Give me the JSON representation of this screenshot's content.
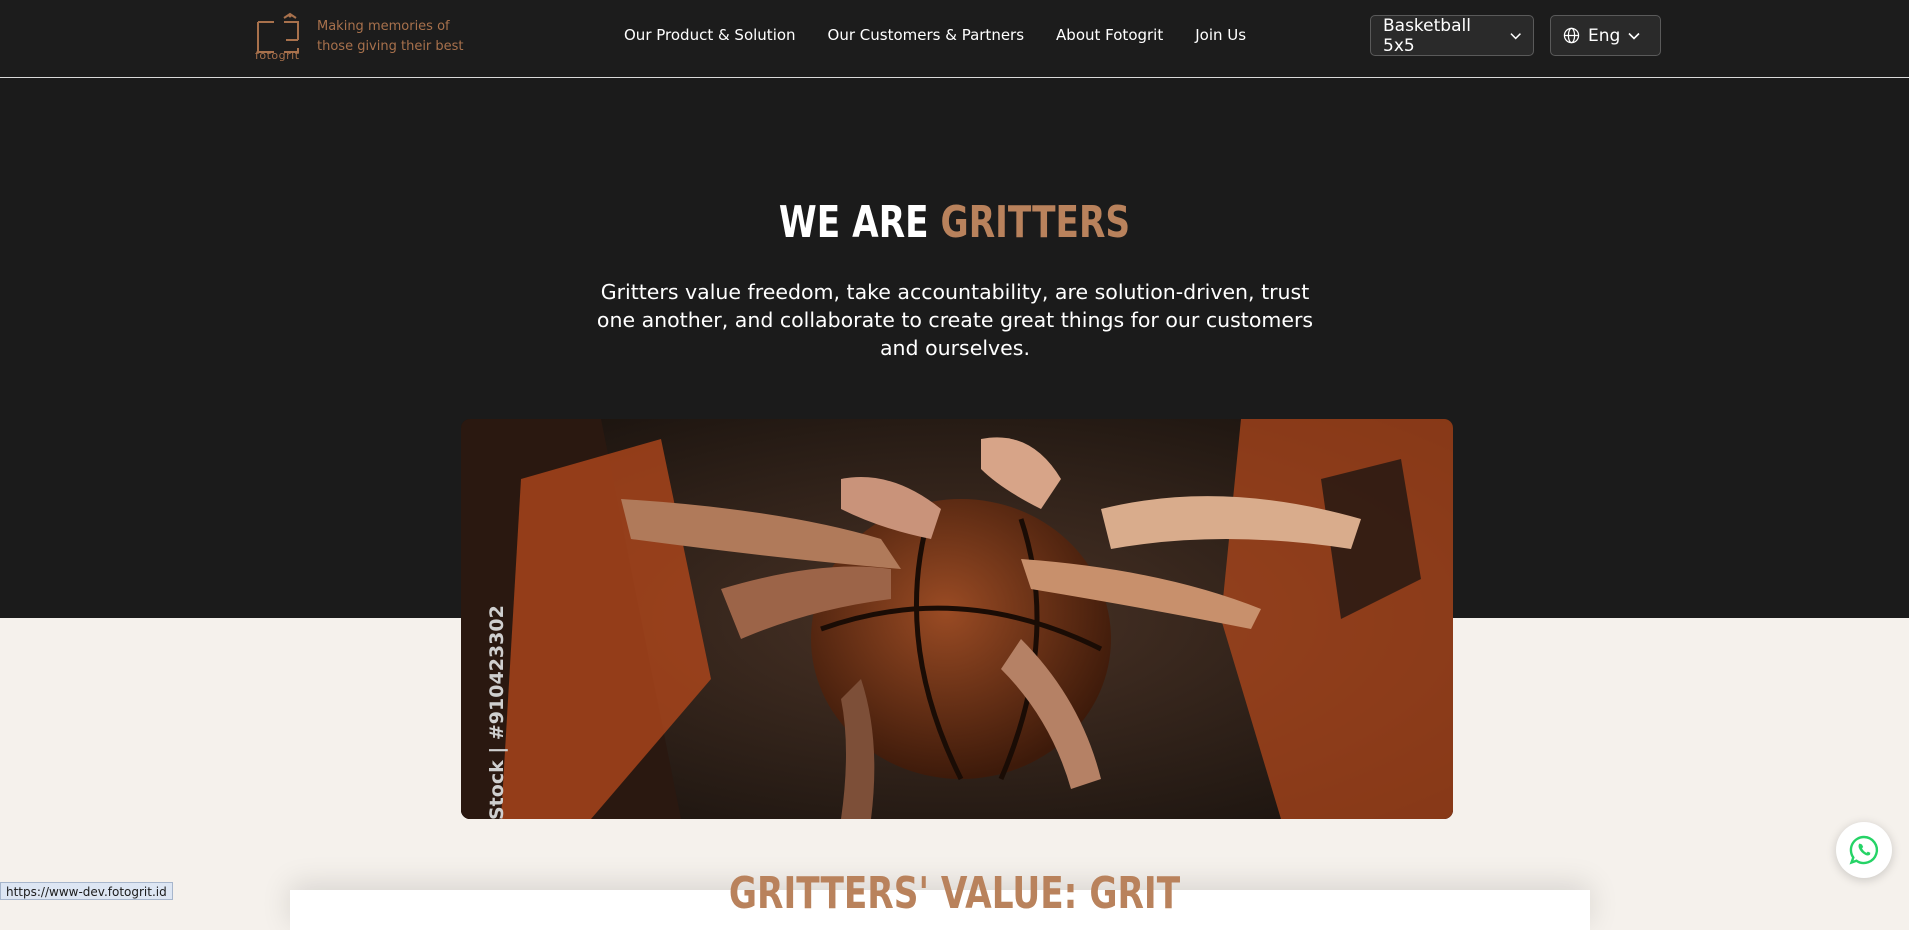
{
  "brand": {
    "logo_word": "fotogrit",
    "tagline": "Making memories of those giving their best"
  },
  "nav": {
    "items": [
      "Our Product & Solution",
      "Our Customers & Partners",
      "About Fotogrit",
      "Join Us"
    ]
  },
  "controls": {
    "sport": "Basketball 5x5",
    "language": "Eng"
  },
  "hero": {
    "title_white": "WE ARE",
    "title_accent": "GRITTERS",
    "subtitle": "Gritters value freedom, take accountability, are solution-driven, trust one another, and collaborate to create great things for our customers and ourselves.",
    "image_label": "Stock | #910423302"
  },
  "next_section": {
    "title": "GRITTERS' VALUE: GRIT"
  },
  "status_bar": {
    "url": "https://www-dev.fotogrit.id"
  },
  "colors": {
    "header_bg": "#1c1c1c",
    "hero_bg": "#1b1b1b",
    "accent": "#b9825c",
    "page_bg": "#f5f1ec",
    "whatsapp": "#25d366"
  },
  "icons": {
    "logo": "fotogrit-camera-logo",
    "globe": "globe-icon",
    "chevron": "chevron-down-icon",
    "whatsapp": "whatsapp-icon"
  }
}
